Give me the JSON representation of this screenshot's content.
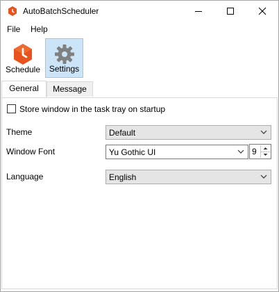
{
  "window": {
    "title": "AutoBatchScheduler",
    "accent": "#e8531d"
  },
  "menu": {
    "items": [
      {
        "label": "File"
      },
      {
        "label": "Help"
      }
    ]
  },
  "toolbar": {
    "schedule_label": "Schedule",
    "settings_label": "Settings"
  },
  "tabs": [
    {
      "label": "General",
      "active": true
    },
    {
      "label": "Message",
      "active": false
    }
  ],
  "general": {
    "tray_checkbox": {
      "label": "Store window in the task tray on startup",
      "checked": false
    },
    "theme": {
      "label": "Theme",
      "value": "Default"
    },
    "window_font": {
      "label": "Window Font",
      "value": "Yu Gothic UI",
      "size": "9"
    },
    "language": {
      "label": "Language",
      "value": "English"
    }
  }
}
